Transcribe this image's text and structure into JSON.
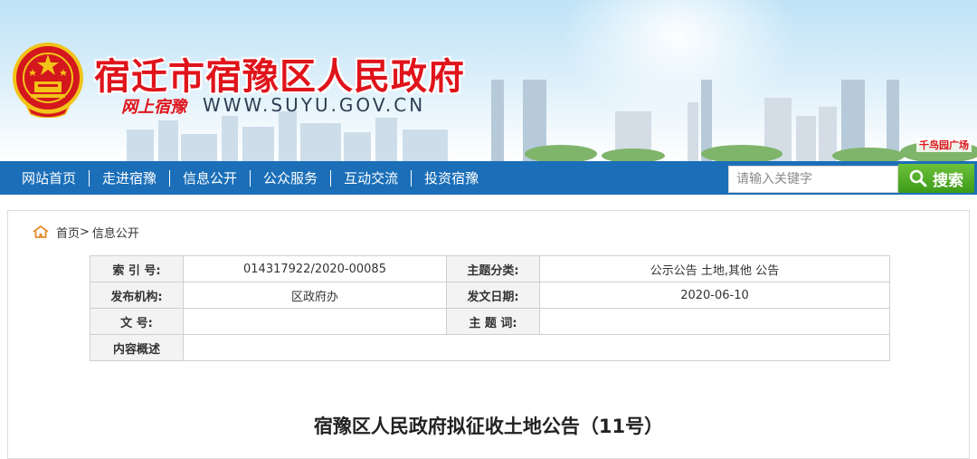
{
  "header": {
    "site_title": "宿迁市宿豫区人民政府",
    "slogan": "网上宿豫",
    "url": "WWW.SUYU.GOV.CN",
    "plaza_tag": "千鸟园广场"
  },
  "nav": {
    "items": [
      {
        "label": "网站首页"
      },
      {
        "label": "走进宿豫"
      },
      {
        "label": "信息公开"
      },
      {
        "label": "公众服务"
      },
      {
        "label": "互动交流"
      },
      {
        "label": "投资宿豫"
      }
    ],
    "search_placeholder": "请输入关键字",
    "search_button": "搜索"
  },
  "breadcrumb": {
    "home": "首页",
    "separator": ">",
    "current": "信息公开"
  },
  "meta": {
    "index_label": "索 引 号:",
    "index_value": "014317922/2020-00085",
    "topic_label": "主题分类:",
    "topic_value": "公示公告  土地,其他    公告",
    "publisher_label": "发布机构:",
    "publisher_value": "区政府办",
    "date_label": "发文日期:",
    "date_value": "2020-06-10",
    "docno_label": "文 号:",
    "docno_value": "",
    "keyword_label": "主 题 词:",
    "keyword_value": "",
    "summary_label": "内容概述",
    "summary_value": ""
  },
  "article": {
    "title": "宿豫区人民政府拟征收土地公告（11号）"
  },
  "colors": {
    "nav_bg": "#1b6fb8",
    "title_red": "#e0141b",
    "search_green": "#4aa821"
  }
}
